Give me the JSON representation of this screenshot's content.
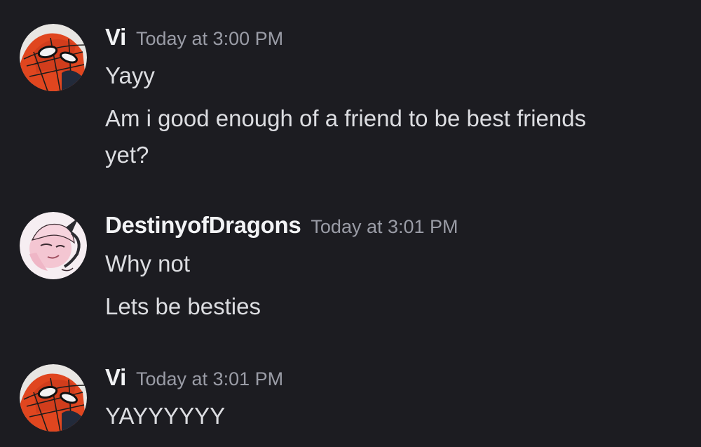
{
  "messages": [
    {
      "author": "Vi",
      "timestamp": "Today at 3:00 PM",
      "avatar_icon": "spiderman-avatar-icon",
      "lines": [
        "Yayy",
        "Am i good enough of a friend to be best friends",
        "yet?"
      ]
    },
    {
      "author": "DestinyofDragons",
      "timestamp": "Today at 3:01 PM",
      "avatar_icon": "pink-demon-avatar-icon",
      "lines": [
        "Why not",
        "Lets be besties"
      ]
    },
    {
      "author": "Vi",
      "timestamp": "Today at 3:01 PM",
      "avatar_icon": "spiderman-avatar-icon",
      "lines": [
        "YAYYYYYY"
      ]
    }
  ],
  "colors": {
    "background": "#1c1c21",
    "username": "#f2f3f5",
    "timestamp": "#9a9ca6",
    "message_text": "#dcdde1"
  }
}
